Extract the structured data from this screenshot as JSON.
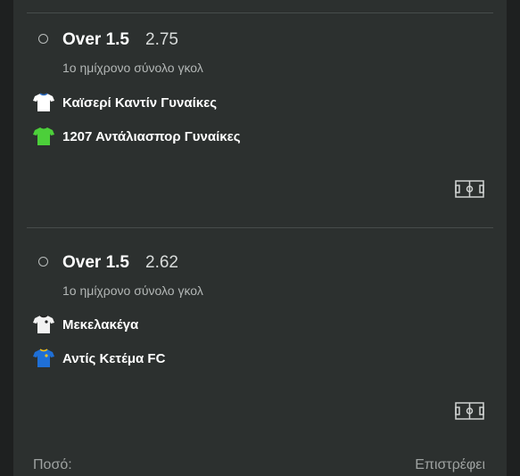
{
  "bets": [
    {
      "selection": "Over 1.5",
      "odds": "2.75",
      "market": "1ο ημίχρονο σύνολο γκολ",
      "home_team": {
        "name": "Καϊσερί Καντίν Γυναίκες",
        "shirt_icon": "white-shirt-icon",
        "shirt_color": "#ffffff"
      },
      "away_team": {
        "name": "1207 Αντάλιασπορ Γυναίκες",
        "shirt_icon": "green-shirt-icon",
        "shirt_color": "#4ccf3a"
      },
      "stats_icon": "pitch-icon"
    },
    {
      "selection": "Over 1.5",
      "odds": "2.62",
      "market": "1ο ημίχρονο σύνολο γκολ",
      "home_team": {
        "name": "Μεκελακέγα",
        "shirt_icon": "white-shirt-icon",
        "shirt_color": "#f2f2f2"
      },
      "away_team": {
        "name": "Αντίς Κετέμα FC",
        "shirt_icon": "blue-shirt-icon",
        "shirt_color": "#1f6fd6"
      },
      "stats_icon": "pitch-icon"
    }
  ],
  "footer": {
    "stake_label": "Ποσό:",
    "returns_label": "Επιστρέφει"
  },
  "colors": {
    "panel_bg": "#2c302f",
    "page_bg": "#1e2020",
    "divider": "#474c4b"
  }
}
